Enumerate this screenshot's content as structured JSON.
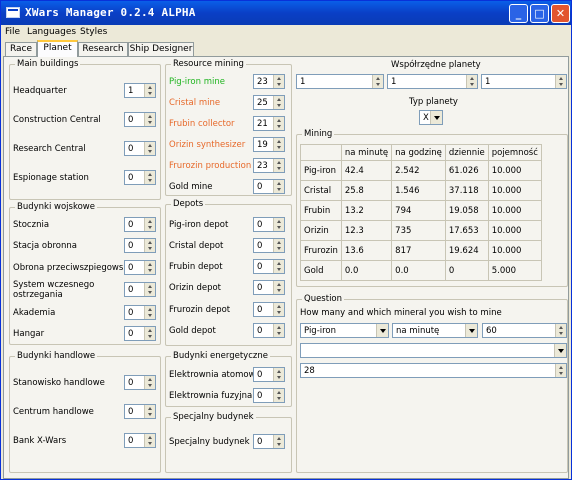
{
  "window": {
    "title": "XWars Manager  0.2.4 ALPHA",
    "min": "_",
    "max": "□",
    "close": "✕"
  },
  "menu": [
    "File",
    "Languages",
    "Styles"
  ],
  "tabs": [
    "Race",
    "Planet",
    "Research",
    "Ship Designer"
  ],
  "colors": {
    "green": "#21b521",
    "orange": "#e7692a"
  },
  "main_buildings": {
    "label": "Main buildings",
    "items": [
      {
        "label": "Headquarter",
        "value": "1"
      },
      {
        "label": "Construction Central",
        "value": "0"
      },
      {
        "label": "Research Central",
        "value": "0"
      },
      {
        "label": "Espionage station",
        "value": "0"
      }
    ]
  },
  "military": {
    "label": "Budynki wojskowe",
    "items": [
      {
        "label": "Stocznia",
        "value": "0"
      },
      {
        "label": "Stacja obronna",
        "value": "0"
      },
      {
        "label": "Obrona przeciwszpiegowska",
        "value": "0"
      },
      {
        "label": "System wczesnego ostrzegania",
        "value": "0"
      },
      {
        "label": "Akademia",
        "value": "0"
      },
      {
        "label": "Hangar",
        "value": "0"
      }
    ]
  },
  "trade": {
    "label": "Budynki handlowe",
    "items": [
      {
        "label": "Stanowisko handlowe",
        "value": "0"
      },
      {
        "label": "Centrum handlowe",
        "value": "0"
      },
      {
        "label": "Bank X-Wars",
        "value": "0"
      }
    ]
  },
  "resource_mining": {
    "label": "Resource mining",
    "items": [
      {
        "label": "Pig-iron mine",
        "value": "23",
        "color": "green"
      },
      {
        "label": "Cristal mine",
        "value": "25",
        "color": "orange"
      },
      {
        "label": "Frubin collector",
        "value": "21",
        "color": "orange"
      },
      {
        "label": "Orizin synthesizer",
        "value": "19",
        "color": "orange"
      },
      {
        "label": "Frurozin production",
        "value": "23",
        "color": "orange"
      },
      {
        "label": "Gold mine",
        "value": "0",
        "color": "black"
      }
    ]
  },
  "depots": {
    "label": "Depots",
    "items": [
      {
        "label": "Pig-iron depot",
        "value": "0"
      },
      {
        "label": "Cristal depot",
        "value": "0"
      },
      {
        "label": "Frubin depot",
        "value": "0"
      },
      {
        "label": "Orizin depot",
        "value": "0"
      },
      {
        "label": "Frurozin depot",
        "value": "0"
      },
      {
        "label": "Gold depot",
        "value": "0"
      }
    ]
  },
  "energy": {
    "label": "Budynki energetyczne",
    "items": [
      {
        "label": "Elektrownia atomowa",
        "value": "0"
      },
      {
        "label": "Elektrownia fuzyjna",
        "value": "0"
      }
    ]
  },
  "special": {
    "label": "Specjalny budynek",
    "items": [
      {
        "label": "Specjalny budynek",
        "value": "0"
      }
    ]
  },
  "coords": {
    "label": "Współrzędne planety",
    "x": "1",
    "y": "1",
    "z": "1"
  },
  "planet_type": {
    "label": "Typ planety",
    "value": "X"
  },
  "mining": {
    "label": "Mining",
    "headers": [
      "",
      "na minutę",
      "na godzinę",
      "dziennie",
      "pojemność"
    ],
    "rows": [
      [
        "Pig-iron",
        "42.4",
        "2.542",
        "61.026",
        "10.000"
      ],
      [
        "Cristal",
        "25.8",
        "1.546",
        "37.118",
        "10.000"
      ],
      [
        "Frubin",
        "13.2",
        "794",
        "19.058",
        "10.000"
      ],
      [
        "Orizin",
        "12.3",
        "735",
        "17.653",
        "10.000"
      ],
      [
        "Frurozin",
        "13.6",
        "817",
        "19.624",
        "10.000"
      ],
      [
        "Gold",
        "0.0",
        "0.0",
        "0",
        "5.000"
      ]
    ]
  },
  "question": {
    "label": "Question",
    "text": "How many and which mineral you wish to mine",
    "mineral": "Pig-iron",
    "unit": "na minutę",
    "amount": "60",
    "combo": "",
    "result": "28"
  }
}
